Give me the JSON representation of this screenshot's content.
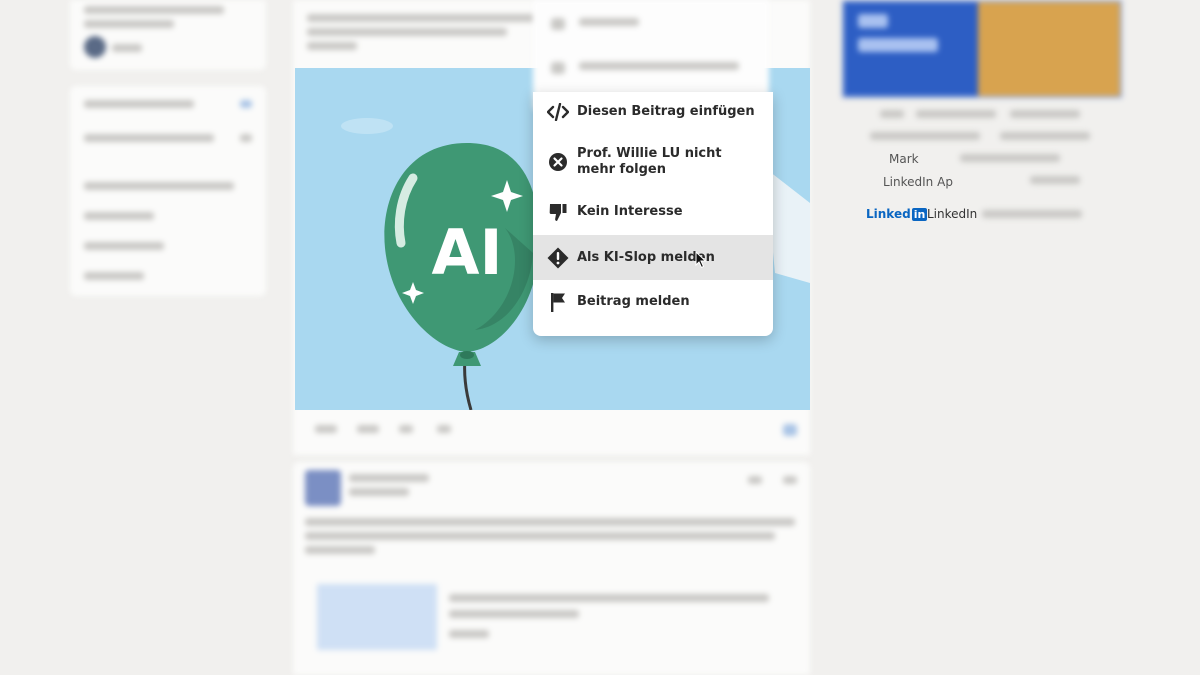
{
  "context_menu": {
    "items": [
      {
        "label": "Diesen Beitrag einfügen",
        "icon": "code-embed-icon"
      },
      {
        "label": "Prof. Willie LU nicht mehr folgen",
        "icon": "close-circle-icon"
      },
      {
        "label": "Kein Interesse",
        "icon": "thumbs-down-icon"
      },
      {
        "label": "Als KI-Slop melden",
        "icon": "warning-diamond-icon",
        "hovered": true
      },
      {
        "label": "Beitrag melden",
        "icon": "flag-icon"
      }
    ]
  },
  "post_image": {
    "balloon_text": "AI",
    "balloon_color": "#3f9874",
    "background_color": "#a9d8f0"
  },
  "footer": {
    "partial_marketing": "Mark",
    "partial_apps": "LinkedIn Ap",
    "brand_logo": "Linked",
    "brand_logo_in": "in",
    "brand_text": "LinkedIn"
  },
  "colors": {
    "linkedin_blue": "#0a66c2",
    "hover_bg": "#e4e4e4",
    "page_bg": "#f1f0ee"
  }
}
